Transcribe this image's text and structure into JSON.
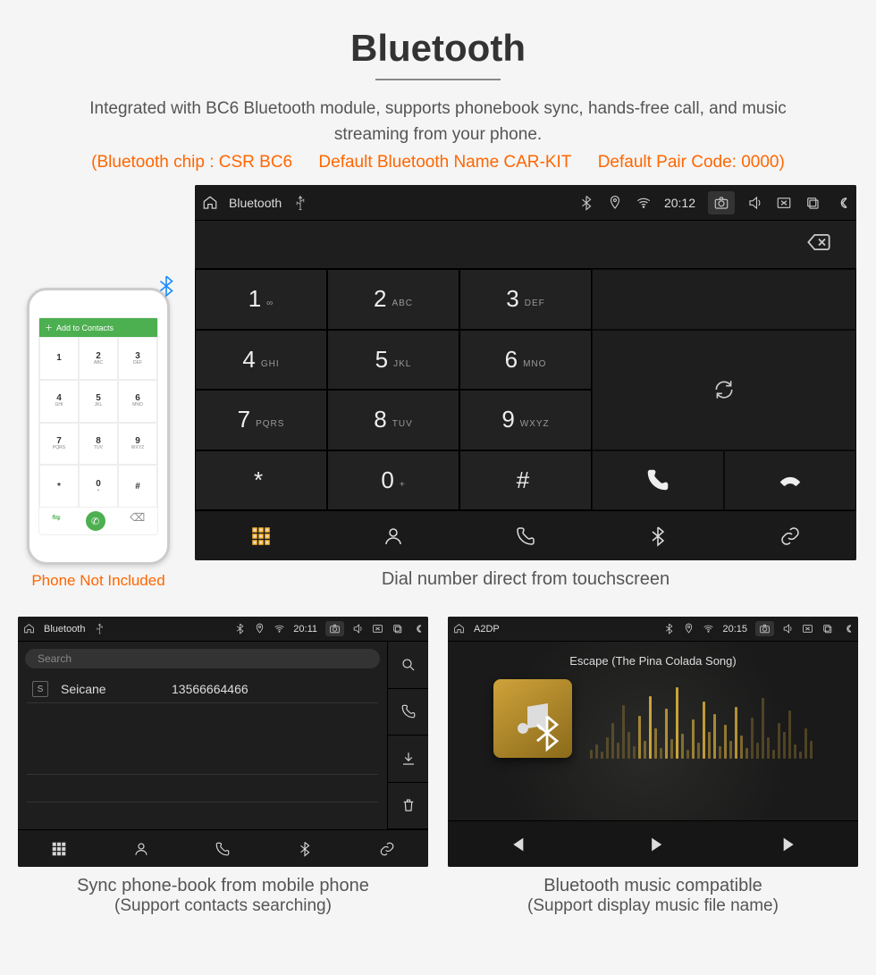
{
  "heading": "Bluetooth",
  "subtitle": "Integrated with BC6 Bluetooth module, supports phonebook sync, hands-free call, and music streaming from your phone.",
  "specs": {
    "chip": "(Bluetooth chip : CSR BC6",
    "name": "Default Bluetooth Name CAR-KIT",
    "pair": "Default Pair Code: 0000)"
  },
  "phone": {
    "top_label": "Add to Contacts",
    "keys": [
      "1",
      "2",
      "3",
      "4",
      "5",
      "6",
      "7",
      "8",
      "9",
      "*",
      "0",
      "#"
    ],
    "subs": [
      "",
      "ABC",
      "DEF",
      "GHI",
      "JKL",
      "MNO",
      "PQRS",
      "TUV",
      "WXYZ",
      "",
      "+",
      ""
    ],
    "not_included": "Phone Not Included"
  },
  "main_unit": {
    "title": "Bluetooth",
    "time": "20:12",
    "keys": [
      {
        "n": "1",
        "s": "∞"
      },
      {
        "n": "2",
        "s": "ABC"
      },
      {
        "n": "3",
        "s": "DEF"
      },
      {
        "n": "4",
        "s": "GHI"
      },
      {
        "n": "5",
        "s": "JKL"
      },
      {
        "n": "6",
        "s": "MNO"
      },
      {
        "n": "7",
        "s": "PQRS"
      },
      {
        "n": "8",
        "s": "TUV"
      },
      {
        "n": "9",
        "s": "WXYZ"
      },
      {
        "n": "*",
        "s": ""
      },
      {
        "n": "0",
        "s": "+"
      },
      {
        "n": "#",
        "s": ""
      }
    ],
    "caption": "Dial number direct from touchscreen"
  },
  "phonebook_unit": {
    "title": "Bluetooth",
    "time": "20:11",
    "search_placeholder": "Search",
    "contact_name": "Seicane",
    "contact_number": "13566664466",
    "caption1": "Sync phone-book from mobile phone",
    "caption2": "(Support contacts searching)"
  },
  "music_unit": {
    "title": "A2DP",
    "time": "20:15",
    "song": "Escape (The Pina Colada Song)",
    "caption1": "Bluetooth music compatible",
    "caption2": "(Support display music file name)"
  }
}
